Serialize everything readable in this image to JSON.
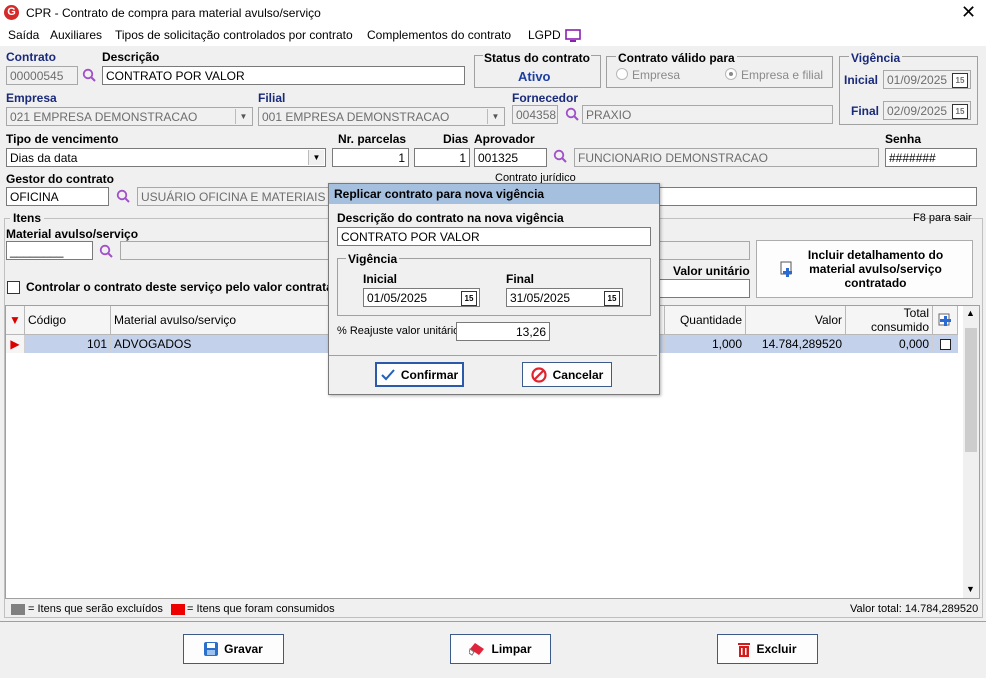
{
  "window": {
    "title": "CPR - Contrato de compra para material avulso/serviço",
    "close": "✕"
  },
  "menu": [
    "Saída",
    "Auxiliares",
    "Tipos de solicitação controlados por contrato",
    "Complementos do contrato",
    "LGPD"
  ],
  "contrato": {
    "label": "Contrato",
    "value": "00000545"
  },
  "descricao": {
    "label": "Descrição",
    "value": "CONTRATO POR VALOR"
  },
  "status": {
    "label": "Status do contrato",
    "value": "Ativo"
  },
  "contrato_valido": {
    "label": "Contrato válido para",
    "option1": "Empresa",
    "option2": "Empresa e filial"
  },
  "vigencia": {
    "label": "Vigência",
    "inicial_label": "Inicial",
    "inicial": "01/09/2025",
    "final_label": "Final",
    "final": "02/09/2025"
  },
  "empresa": {
    "label": "Empresa",
    "value": "021 EMPRESA DEMONSTRACAO"
  },
  "filial": {
    "label": "Filial",
    "value": "001 EMPRESA DEMONSTRACAO"
  },
  "fornecedor": {
    "label": "Fornecedor",
    "code": "004358",
    "name": "PRAXIO"
  },
  "tipo_venc": {
    "label": "Tipo de vencimento",
    "value": "Dias da data"
  },
  "nr_parcelas": {
    "label": "Nr. parcelas",
    "value": "1"
  },
  "dias": {
    "label": "Dias",
    "value": "1"
  },
  "aprovador": {
    "label": "Aprovador",
    "code": "001325",
    "name": "FUNCIONARIO DEMONSTRACAO"
  },
  "senha": {
    "label": "Senha",
    "value": "#######"
  },
  "gestor": {
    "label": "Gestor do contrato",
    "code": "OFICINA",
    "name": "USUÁRIO OFICINA E MATERIAIS"
  },
  "contrato_juridico": {
    "label": "Contrato jurídico"
  },
  "itens": {
    "label": "Itens",
    "hint": "F8 para sair"
  },
  "material": {
    "label": "Material avulso/serviço",
    "code": "________"
  },
  "controlar": {
    "label": "Controlar o contrato deste serviço pelo valor contrata"
  },
  "valor_unitario": {
    "label": "Valor unitário"
  },
  "incluir_btn": {
    "label": "Incluir detalhamento do material avulso/serviço contratado"
  },
  "grid": {
    "columns": [
      "Código",
      "Material avulso/serviço",
      "Quantidade",
      "Valor",
      "Total consumido"
    ],
    "rows": [
      {
        "codigo": "101",
        "material": "ADVOGADOS",
        "quantidade": "1,000",
        "valor": "14.784,289520",
        "total": "0,000"
      }
    ]
  },
  "legend": {
    "excluidos": "= Itens que serão excluídos",
    "consumidos": "= Itens que foram consumidos",
    "total": "Valor total: 14.784,289520"
  },
  "buttons": {
    "gravar": "Gravar",
    "limpar": "Limpar",
    "excluir": "Excluir"
  },
  "dialog": {
    "title": "Replicar contrato para nova vigência",
    "desc_label": "Descrição do contrato na nova vigência",
    "desc_value": "CONTRATO POR VALOR",
    "vig_label": "Vigência",
    "inicial_label": "Inicial",
    "inicial": "01/05/2025",
    "final_label": "Final",
    "final": "31/05/2025",
    "reajuste_label": "% Reajuste valor unitário",
    "reajuste": "13,26",
    "confirmar": "Confirmar",
    "cancelar": "Cancelar"
  },
  "colors": {
    "accent": "#1a2a7a",
    "dialog_title": "#a5c0de",
    "row_selected": "#c3d1ea",
    "status_blue": "#1c3fa0"
  }
}
